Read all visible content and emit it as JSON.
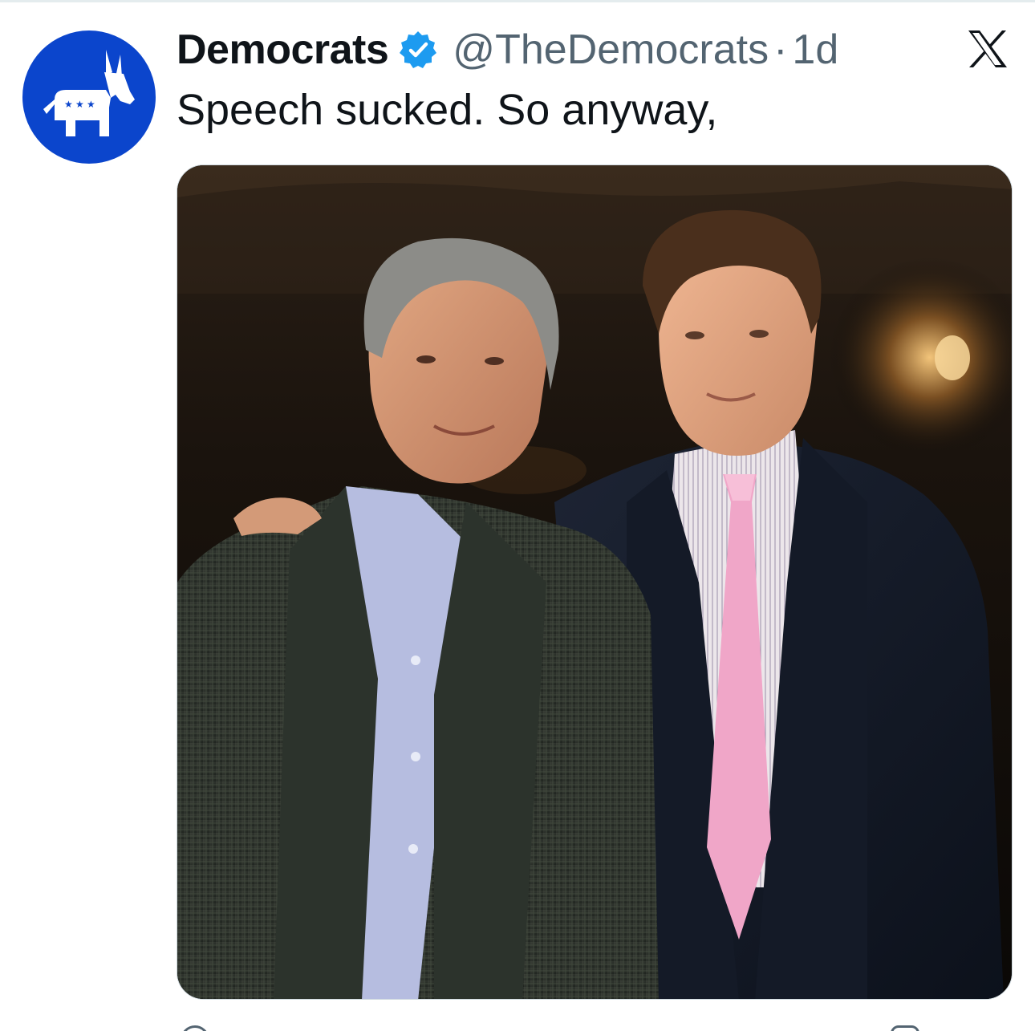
{
  "tweet": {
    "display_name": "Democrats",
    "handle": "@TheDemocrats",
    "separator": "·",
    "time": "1d",
    "text": "Speech sucked. So anyway,",
    "verified": true
  },
  "icons": {
    "avatar": "democratic-donkey-logo",
    "verified": "verified-badge-icon",
    "platform": "x-logo-icon"
  },
  "colors": {
    "avatar_bg": "#0b45cc",
    "verified_blue": "#1d9bf0",
    "text_primary": "#0f1419",
    "text_secondary": "#536471"
  }
}
